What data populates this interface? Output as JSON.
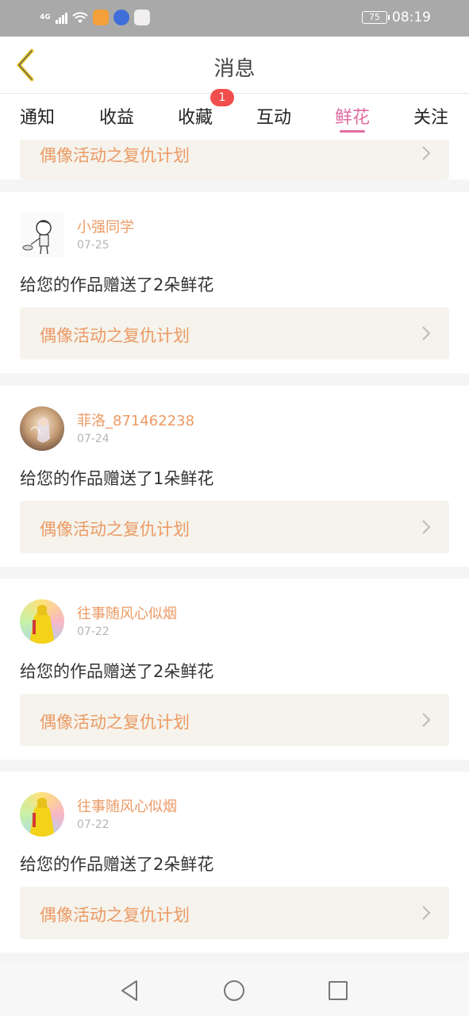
{
  "status_bar": {
    "signal_label": "4G",
    "battery": "75",
    "time": "08:19",
    "app_icons": [
      "weibo-icon",
      "baidu-icon",
      "map-icon"
    ]
  },
  "header": {
    "title": "消息",
    "back_icon": "back-chevron-icon",
    "back_color": "#e8c83c"
  },
  "tabs": [
    {
      "label": "通知"
    },
    {
      "label": "收益"
    },
    {
      "label": "收藏",
      "badge": "1"
    },
    {
      "label": "互动"
    },
    {
      "label": "鲜花",
      "active": true
    },
    {
      "label": "关注"
    }
  ],
  "accent_color": "#e06ca0",
  "partial_activity": "偶像活动之复仇计划",
  "cards": [
    {
      "user": "小强同学",
      "date": "07-25",
      "message": "给您的作品赠送了2朵鲜花",
      "activity": "偶像活动之复仇计划",
      "avatar": "sketch-boy-avatar"
    },
    {
      "user": "菲洛_871462238",
      "date": "07-24",
      "message": "给您的作品赠送了1朵鲜花",
      "activity": "偶像活动之复仇计划",
      "avatar": "fantasy-girl-avatar"
    },
    {
      "user": "往事随风心似烟",
      "date": "07-22",
      "message": "给您的作品赠送了2朵鲜花",
      "activity": "偶像活动之复仇计划",
      "avatar": "yellow-dress-avatar"
    },
    {
      "user": "往事随风心似烟",
      "date": "07-22",
      "message": "给您的作品赠送了2朵鲜花",
      "activity": "偶像活动之复仇计划",
      "avatar": "yellow-dress-avatar"
    }
  ],
  "nav": {
    "back": "triangle-back-icon",
    "home": "circle-home-icon",
    "recents": "square-recents-icon"
  }
}
